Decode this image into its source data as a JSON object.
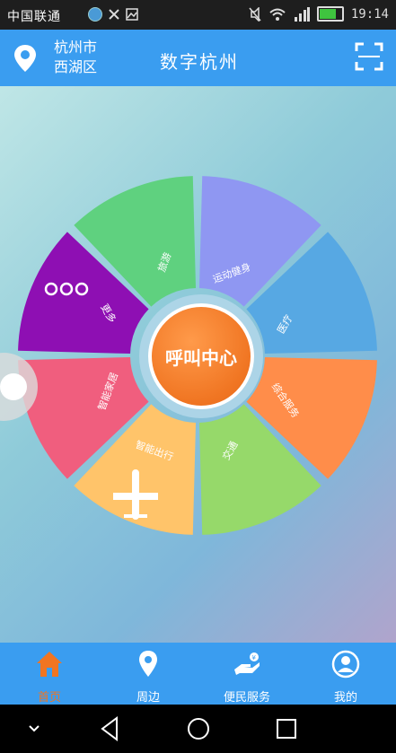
{
  "statusbar": {
    "carrier": "中国联通",
    "time": "19:14"
  },
  "header": {
    "city_line1": "杭州市",
    "city_line2": "西湖区",
    "title": "数字杭州"
  },
  "wheel": {
    "center_label": "呼叫中心",
    "segments": [
      {
        "label": "旅游",
        "color": "#5fd17f"
      },
      {
        "label": "运动健身",
        "color": "#8f97f2"
      },
      {
        "label": "医疗",
        "color": "#57a8e3"
      },
      {
        "label": "综合服务",
        "color": "#ff8d4a"
      },
      {
        "label": "交通",
        "color": "#96d96a"
      },
      {
        "label": "智能出行",
        "color": "#ffc46a"
      },
      {
        "label": "智能家居",
        "color": "#f05e7e"
      },
      {
        "label": "更多",
        "color": "#8e0fb3"
      }
    ],
    "more_icon": "ellipsis-icon",
    "plane_icon": "airplane-icon"
  },
  "tabbar": {
    "tabs": [
      {
        "label": "首页",
        "icon": "home-icon",
        "active": true
      },
      {
        "label": "周边",
        "icon": "location-pin-icon",
        "active": false
      },
      {
        "label": "便民服务",
        "icon": "service-hand-icon",
        "active": false
      },
      {
        "label": "我的",
        "icon": "user-icon",
        "active": false
      }
    ],
    "active_color": "#f07522"
  },
  "colors": {
    "primary": "#3a9df0",
    "accent": "#f07522"
  }
}
